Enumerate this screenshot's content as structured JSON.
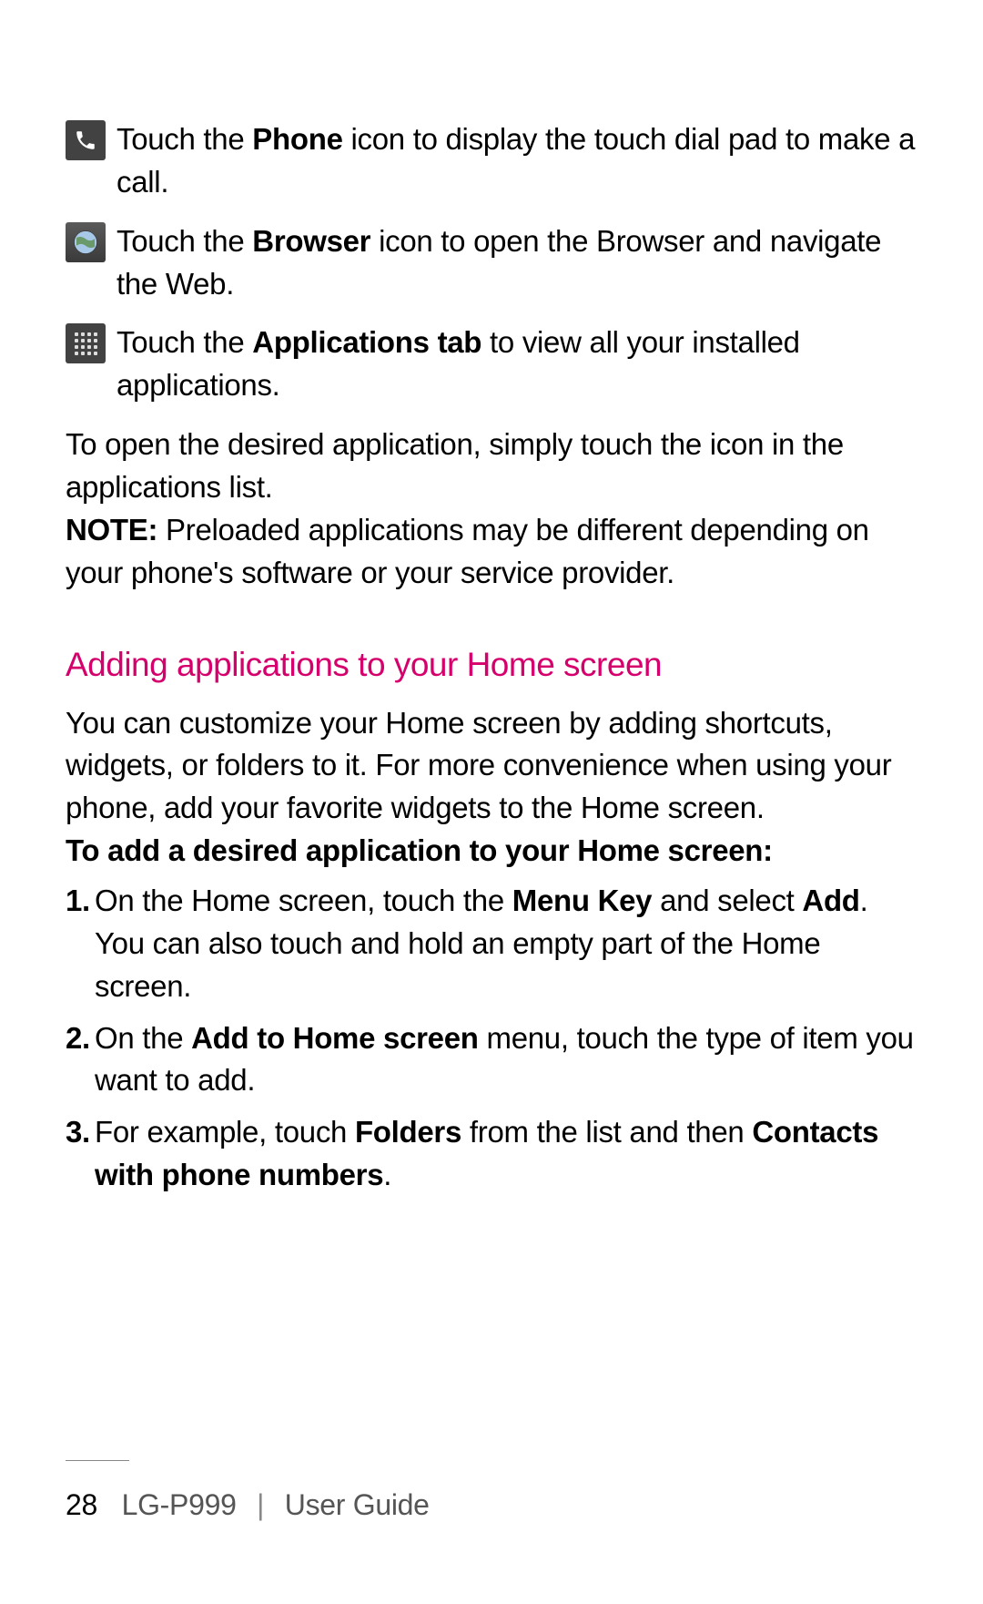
{
  "iconItems": [
    {
      "icon": "phone-icon",
      "textParts": [
        "Touch the ",
        "Phone",
        " icon to display the touch dial pad to make a call."
      ]
    },
    {
      "icon": "browser-icon",
      "textParts": [
        "Touch the ",
        "Browser",
        " icon to open the Browser and navigate the Web."
      ]
    },
    {
      "icon": "apps-icon",
      "textParts": [
        "Touch the ",
        "Applications tab",
        " to view all your installed applications."
      ]
    }
  ],
  "openPara": "To open the desired application, simply touch the icon in the applications list.",
  "notePara": {
    "label": "NOTE:",
    "text": " Preloaded applications may be different depending on your phone's software or your service provider."
  },
  "heading": "Adding applications to your Home screen",
  "customizePara": "You can customize your Home screen by adding shortcuts, widgets, or folders to it. For more convenience when using your phone, add your favorite widgets to the Home screen.",
  "subheading": "To add a desired application to your Home screen:",
  "steps": [
    {
      "num": "1.",
      "parts": [
        " On the Home screen, touch the ",
        "Menu Key",
        " and select ",
        "Add",
        ". You can also touch and hold an empty part of the Home screen."
      ]
    },
    {
      "num": "2.",
      "parts": [
        "On the ",
        "Add to Home screen",
        " menu, touch the type of item you want to add."
      ]
    },
    {
      "num": "3.",
      "parts": [
        "For example, touch ",
        "Folders",
        " from the list and then ",
        "Contacts with phone numbers",
        "."
      ]
    }
  ],
  "footer": {
    "pageNum": "28",
    "model": "LG-P999",
    "label": "User Guide"
  }
}
